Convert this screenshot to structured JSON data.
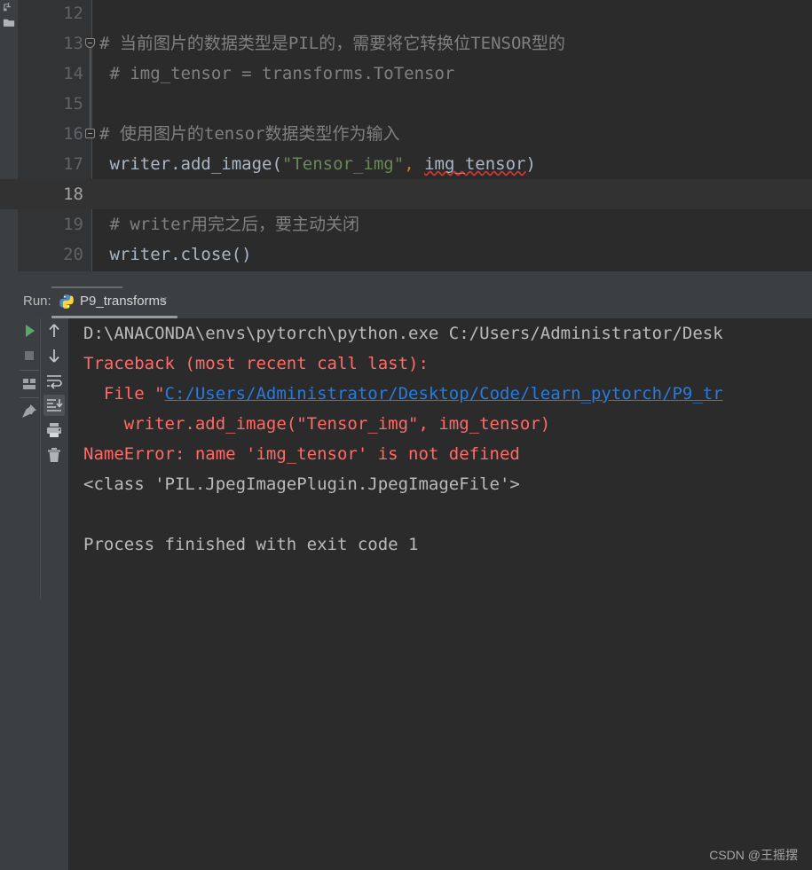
{
  "editor": {
    "lines": [
      {
        "num": "12",
        "segments": [],
        "fold": null,
        "current": false
      },
      {
        "num": "13",
        "segments": [
          {
            "t": "# 当前图片的数据类型是PIL的，需要将它转换位TENSOR型的",
            "c": "cm"
          }
        ],
        "fold": "start",
        "current": false
      },
      {
        "num": "14",
        "segments": [
          {
            "t": " # img_tensor = transforms.ToTensor",
            "c": "cm"
          }
        ],
        "fold": null,
        "current": false
      },
      {
        "num": "15",
        "segments": [],
        "fold": null,
        "current": false
      },
      {
        "num": "16",
        "segments": [
          {
            "t": "# 使用图片的tensor数据类型作为输入",
            "c": "cm"
          }
        ],
        "fold": "end",
        "current": false
      },
      {
        "num": "17",
        "segments": [
          {
            "t": " writer.add_image(",
            "c": "ident"
          },
          {
            "t": "\"Tensor_img\"",
            "c": "kw-str"
          },
          {
            "t": ",",
            "c": "punct-o"
          },
          {
            "t": " ",
            "c": "ident"
          },
          {
            "t": "img_tensor",
            "c": "ident squiggle"
          },
          {
            "t": ")",
            "c": "ident"
          }
        ],
        "fold": null,
        "current": false
      },
      {
        "num": "18",
        "segments": [],
        "fold": null,
        "current": true
      },
      {
        "num": "19",
        "segments": [
          {
            "t": " # writer用完之后，要主动关闭",
            "c": "cm"
          }
        ],
        "fold": null,
        "current": false
      },
      {
        "num": "20",
        "segments": [
          {
            "t": " writer.close()",
            "c": "ident"
          }
        ],
        "fold": null,
        "current": false
      }
    ]
  },
  "run_panel": {
    "run_label": "Run:",
    "tab_name": "P9_transforms",
    "tab_close": "×",
    "python_icon": "python-icon",
    "toolbar_left": [
      {
        "name": "rerun-icon",
        "glyph": "play-triangle"
      },
      {
        "name": "stop-icon",
        "glyph": "square"
      },
      {
        "name": "layout-icon",
        "glyph": "panes"
      },
      {
        "name": "pin-tab-icon",
        "glyph": "pin"
      }
    ],
    "toolbar_right": [
      {
        "name": "up-the-stack-trace-icon",
        "glyph": "arrow-up"
      },
      {
        "name": "down-the-stack-trace-icon",
        "glyph": "arrow-down"
      },
      {
        "name": "soft-wrap-icon",
        "glyph": "wrap"
      },
      {
        "name": "scroll-to-end-icon",
        "glyph": "scroll-end",
        "selected": true
      },
      {
        "name": "print-icon",
        "glyph": "printer"
      },
      {
        "name": "clear-all-icon",
        "glyph": "trash"
      }
    ]
  },
  "console": {
    "lines": [
      {
        "segments": [
          {
            "t": "D:\\ANACONDA\\envs\\pytorch\\python.exe C:/Users/Administrator/Desk",
            "c": ""
          }
        ]
      },
      {
        "segments": [
          {
            "t": "Traceback (most recent call last):",
            "c": "err"
          }
        ]
      },
      {
        "segments": [
          {
            "t": "  File \"",
            "c": "err"
          },
          {
            "t": "C:/Users/Administrator/Desktop/Code/learn_pytorch/P9_tr",
            "c": "link"
          }
        ]
      },
      {
        "segments": [
          {
            "t": "    writer.add_image(\"Tensor_img\", img_tensor)",
            "c": "err"
          }
        ]
      },
      {
        "segments": [
          {
            "t": "NameError: name 'img_tensor' is not defined",
            "c": "err"
          }
        ]
      },
      {
        "segments": [
          {
            "t": "<class 'PIL.JpegImagePlugin.JpegImageFile'>",
            "c": ""
          }
        ]
      },
      {
        "segments": []
      },
      {
        "segments": [
          {
            "t": "Process finished with exit code 1",
            "c": ""
          }
        ]
      }
    ]
  },
  "watermark": "CSDN @王摇摆",
  "colors": {
    "editor_bg": "#2b2b2b",
    "gutter_bg": "#313335",
    "chrome_bg": "#3c3f41",
    "current_line_bg": "#323232",
    "comment": "#808080",
    "identifier": "#a9b7c6",
    "string": "#6a8759",
    "orange": "#cc7832",
    "error_red": "#ff6b68",
    "link_blue": "#287bde",
    "console_text": "#bbbbbb"
  }
}
